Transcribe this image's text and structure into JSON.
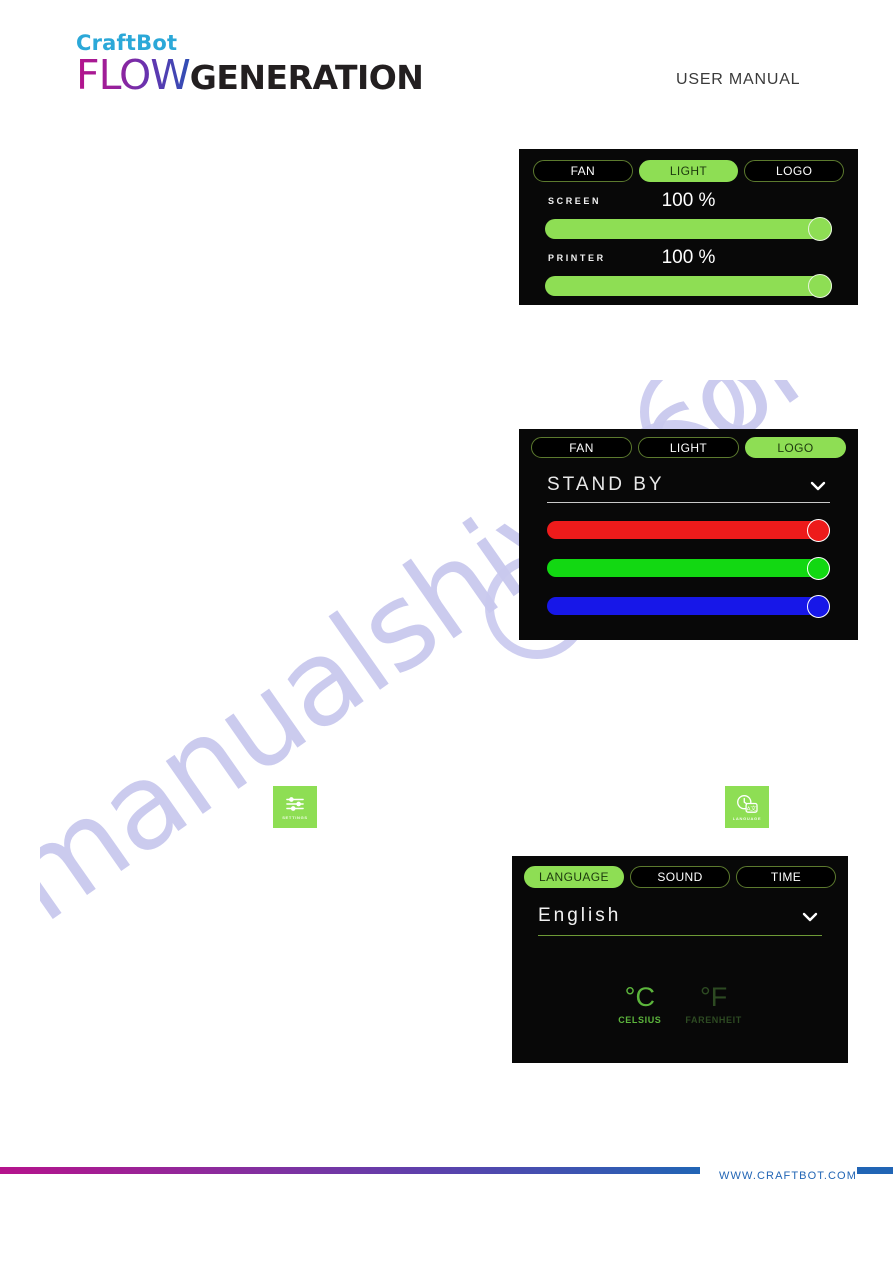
{
  "header": {
    "logo_top": "CraftBot",
    "logo_flow": "FLOW",
    "logo_generation": "GENERATION",
    "doc_type": "USER MANUAL"
  },
  "watermark": {
    "text": "manualshive.com"
  },
  "light_panel": {
    "tabs": [
      {
        "label": "FAN",
        "active": false
      },
      {
        "label": "LIGHT",
        "active": true
      },
      {
        "label": "LOGO",
        "active": false
      }
    ],
    "screen": {
      "label": "SCREEN",
      "value": "100 %",
      "percent": 100
    },
    "printer": {
      "label": "PRINTER",
      "value": "100 %",
      "percent": 100
    }
  },
  "logo_panel": {
    "tabs": [
      {
        "label": "FAN",
        "active": false
      },
      {
        "label": "LIGHT",
        "active": false
      },
      {
        "label": "LOGO",
        "active": true
      }
    ],
    "mode": {
      "value": "STAND BY"
    },
    "channels": [
      {
        "name": "red",
        "color": "#ed1b1b",
        "percent": 100
      },
      {
        "name": "green",
        "color": "#12d812",
        "percent": 100
      },
      {
        "name": "blue",
        "color": "#1717e8",
        "percent": 100
      }
    ]
  },
  "language_panel": {
    "tabs": [
      {
        "label": "LANGUAGE",
        "active": true
      },
      {
        "label": "SOUND",
        "active": false
      },
      {
        "label": "TIME",
        "active": false
      }
    ],
    "language": {
      "value": "English"
    },
    "units": [
      {
        "glyph": "°C",
        "caption": "CELSIUS",
        "selected": true
      },
      {
        "glyph": "°F",
        "caption": "FARENHEIT",
        "selected": false
      }
    ]
  },
  "app_icons": {
    "settings": {
      "caption": "SETTINGS",
      "icon": "sliders-icon"
    },
    "language": {
      "caption": "LANGUAGE",
      "icon": "translate-clock-icon"
    }
  },
  "footer": {
    "url": "WWW.CRAFTBOT.COM"
  },
  "colors": {
    "accent_green": "#8ede54",
    "brand_magenta": "#b5138c",
    "brand_blue": "#2165b5",
    "panel_background": "#080808"
  }
}
